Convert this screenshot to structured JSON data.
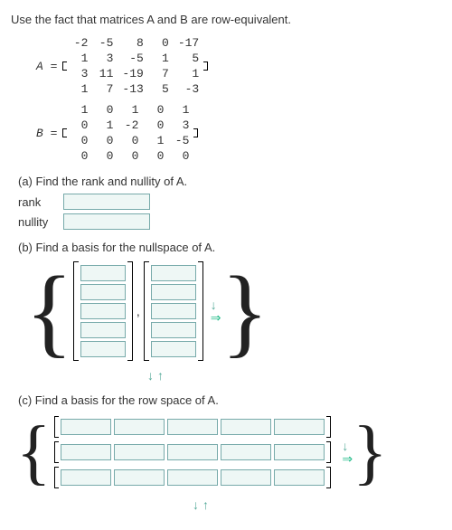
{
  "intro": "Use the fact that matrices A and B are row-equivalent.",
  "matA": {
    "label": "A =",
    "rows": [
      [
        "-2",
        "-5",
        "8",
        "0",
        "-17"
      ],
      [
        "1",
        "3",
        "-5",
        "1",
        "5"
      ],
      [
        "3",
        "11",
        "-19",
        "7",
        "1"
      ],
      [
        "1",
        "7",
        "-13",
        "5",
        "-3"
      ]
    ]
  },
  "matB": {
    "label": "B =",
    "rows": [
      [
        "1",
        "0",
        "1",
        "0",
        "1"
      ],
      [
        "0",
        "1",
        "-2",
        "0",
        "3"
      ],
      [
        "0",
        "0",
        "0",
        "1",
        "-5"
      ],
      [
        "0",
        "0",
        "0",
        "0",
        "0"
      ]
    ]
  },
  "partA": {
    "prompt": "(a) Find the rank and nullity of A.",
    "rank_label": "rank",
    "nullity_label": "nullity",
    "rank_value": "",
    "nullity_value": ""
  },
  "partB": {
    "prompt": "(b) Find a basis for the nullspace of A.",
    "vectors": [
      {
        "cells": [
          "",
          "",
          "",
          "",
          ""
        ]
      },
      {
        "cells": [
          "",
          "",
          "",
          "",
          ""
        ]
      }
    ]
  },
  "partC": {
    "prompt": "(c) Find a basis for the row space of A.",
    "vectors": [
      {
        "cells": [
          "",
          "",
          "",
          "",
          ""
        ]
      },
      {
        "cells": [
          "",
          "",
          "",
          "",
          ""
        ]
      },
      {
        "cells": [
          "",
          "",
          "",
          "",
          ""
        ]
      }
    ]
  },
  "glyphs": {
    "down": "↓",
    "up": "↑",
    "right": "⇒",
    "brace_l": "{",
    "brace_r": "}"
  }
}
